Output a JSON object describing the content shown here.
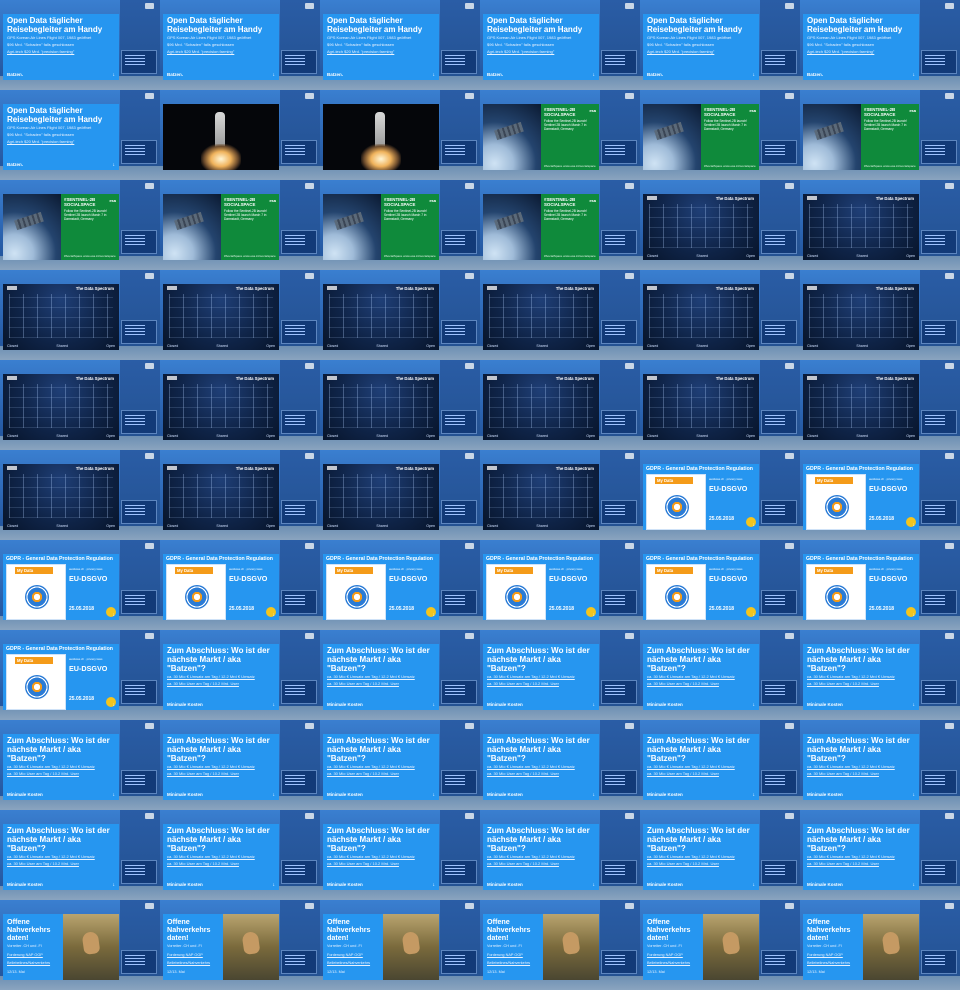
{
  "screen": {
    "columns": 6,
    "rows": 11
  },
  "slides": {
    "opendata": {
      "title": "Open Data täglicher Reisebegleiter am Handy",
      "lines": [
        "GPS Korean Air Lines Flight 007, 1983 geöffnet",
        "$96 Mrd. \"Schaden\" falls geschlossen",
        "Agri-tech $20 Mrd. \"precision farming\""
      ],
      "footer": "Batzen.",
      "arrow": "↓"
    },
    "sentinel": {
      "title": "#SENTINEL-2B SOCIALSPACE",
      "text": "Follow the Sentinel-2B launch! Sentinel 2B launch March 7 in Darmstadt, Germany",
      "footer_left": "#SocialSpace",
      "footer_right": "www.esa.int/socialspace",
      "logo": "esa"
    },
    "spectrum": {
      "logo": "ODI",
      "title": "The Data Spectrum",
      "bottom": [
        "Closed",
        "Shared",
        "Open"
      ]
    },
    "gdpr": {
      "title": "GDPR - General Data Protection Regulation",
      "card_label": "My Data",
      "right_small": "austlaws.ch · privacy laws",
      "right_big": "EU-DSGVO",
      "right_date": "25.05.2018",
      "arrow": "↓"
    },
    "markt": {
      "title": "Zum Abschluss: Wo ist der nächste Markt / aka \"Batzen\"?",
      "lines": [
        "ca. 30 Mio € Umsatz am Tag / 12.2 Mrd € Umsatz",
        "ca. 30 Mio User am Tag / 10.2 Mrd. User"
      ],
      "footer": "Minimale Kosten",
      "arrow": "↓"
    },
    "nahverkehr": {
      "title": "Offene Nahverkehrs daten!",
      "lines": [
        "Vorreiter .CH und .FI",
        "Forderung NAP OGP",
        "Bellebelines/Nahverkehrs",
        "12/13. Mai"
      ]
    }
  },
  "tile_sequence": [
    "opendata",
    "opendata",
    "opendata",
    "opendata",
    "opendata",
    "opendata",
    "opendata",
    "rocket",
    "rocket",
    "sentinel",
    "sentinel",
    "sentinel",
    "sentinel",
    "sentinel",
    "sentinel",
    "sentinel",
    "spectrum",
    "spectrum",
    "spectrum",
    "spectrum",
    "spectrum",
    "spectrum",
    "spectrum",
    "spectrum",
    "spectrum",
    "spectrum",
    "spectrum",
    "spectrum",
    "spectrum",
    "spectrum",
    "spectrum",
    "spectrum",
    "spectrum",
    "spectrum",
    "gdpr",
    "gdpr",
    "gdpr",
    "gdpr",
    "gdpr",
    "gdpr",
    "gdpr",
    "gdpr",
    "gdpr",
    "markt",
    "markt",
    "markt",
    "markt",
    "markt",
    "markt",
    "markt",
    "markt",
    "markt",
    "markt",
    "markt",
    "markt",
    "markt",
    "markt",
    "markt",
    "markt",
    "markt",
    "nahverkehr",
    "nahverkehr",
    "nahverkehr",
    "nahverkehr",
    "nahverkehr",
    "nahverkehr"
  ]
}
